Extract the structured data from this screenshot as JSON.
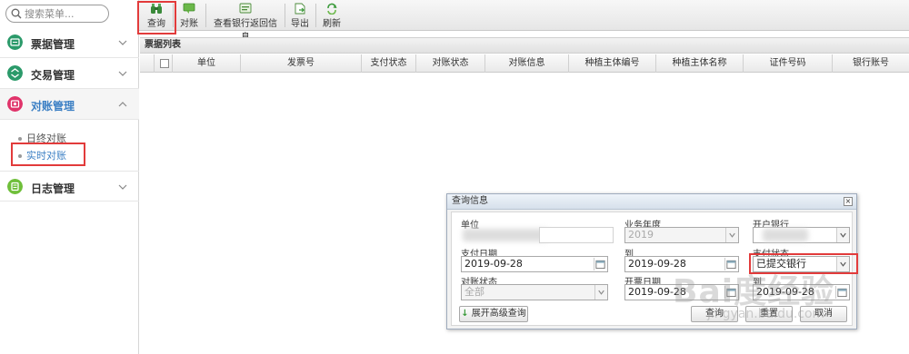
{
  "sidebar": {
    "search_placeholder": "搜索菜单...",
    "groups": [
      {
        "label": "票据管理",
        "icon": "ticket-icon",
        "color": "#2b9a6a",
        "expanded": false
      },
      {
        "label": "交易管理",
        "icon": "exchange-icon",
        "color": "#2b9a6a",
        "expanded": false
      },
      {
        "label": "对账管理",
        "icon": "reconcile-icon",
        "color": "#e0336a",
        "expanded": true
      },
      {
        "label": "日志管理",
        "icon": "log-icon",
        "color": "#6fbf3a",
        "expanded": false
      }
    ],
    "subitems": [
      {
        "label": "日终对账",
        "active": false
      },
      {
        "label": "实时对账",
        "active": true
      }
    ]
  },
  "toolbar": {
    "buttons": [
      {
        "label": "查询",
        "icon": "binoculars-icon"
      },
      {
        "label": "对账",
        "icon": "reconcile-icon"
      },
      {
        "label": "查看银行返回信息",
        "icon": "bank-info-icon"
      },
      {
        "label": "导出",
        "icon": "export-icon"
      },
      {
        "label": "刷新",
        "icon": "refresh-icon"
      }
    ]
  },
  "grid": {
    "title": "票据列表",
    "columns": [
      "单位",
      "发票号",
      "支付状态",
      "对账状态",
      "对账信息",
      "种植主体编号",
      "种植主体名称",
      "证件号码",
      "银行账号"
    ],
    "rows": []
  },
  "dialog": {
    "title": "查询信息",
    "close_glyph": "×",
    "fields": {
      "unit_label": "单位",
      "year_label": "业务年度",
      "year_value": "2019",
      "bank_label": "开户银行",
      "pay_date_label": "支付日期",
      "pay_date_from": "2019-09-28",
      "to_label": "到",
      "pay_date_to": "2019-09-28",
      "pay_status_label": "支付状态",
      "pay_status_value": "已提交银行",
      "reconcile_status_label": "对账状态",
      "reconcile_status_value": "全部",
      "invoice_date_label": "开票日期",
      "invoice_date_from": "2019-09-28",
      "to_label_2": "到",
      "invoice_date_to": "2019-09-28"
    },
    "buttons": {
      "expand": "展开高级查询",
      "query": "查询",
      "reset": "重置",
      "cancel": "取消"
    }
  },
  "watermark": {
    "text": "Bai度经验",
    "sub": "jingyan.baidu.com"
  }
}
